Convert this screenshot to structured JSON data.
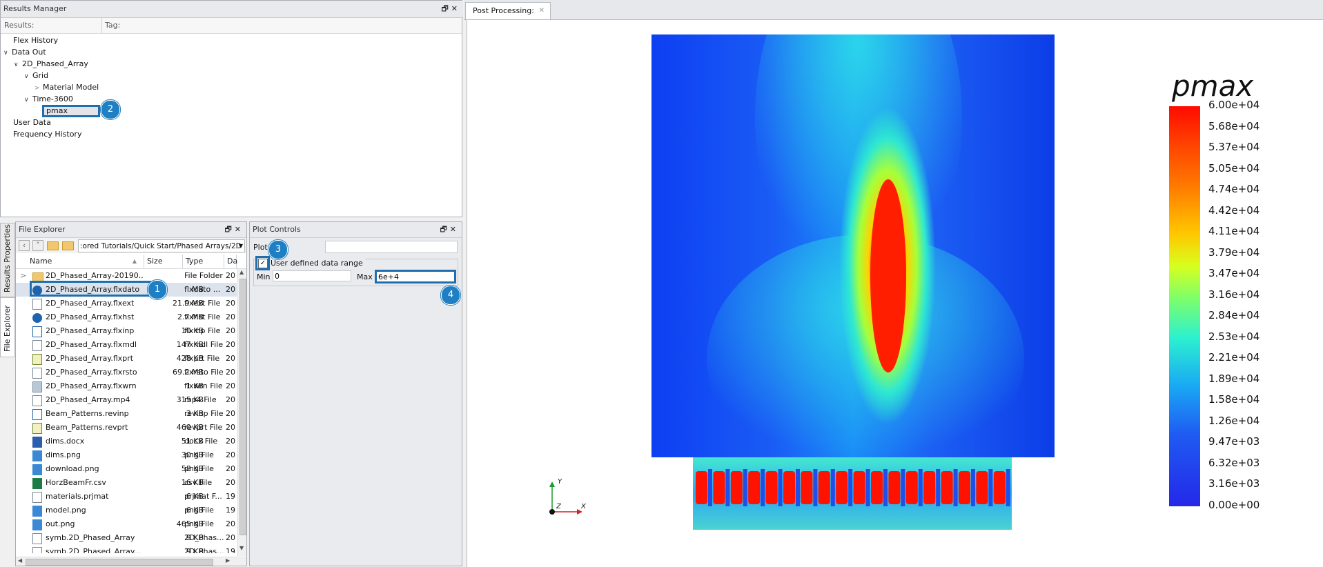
{
  "results_manager": {
    "title": "Results Manager",
    "col_results": "Results:",
    "col_tag": "Tag:",
    "items": [
      {
        "label": "Flex History"
      },
      {
        "label": "Data Out"
      },
      {
        "label": "2D_Phased_Array"
      },
      {
        "label": "Grid"
      },
      {
        "label": "Material Model"
      },
      {
        "label": "Time-3600"
      },
      {
        "label": "pmax"
      },
      {
        "label": "User Data"
      },
      {
        "label": "Frequency History"
      }
    ]
  },
  "side_tabs": {
    "results_properties": "Results Properties",
    "file_explorer": "File Explorer"
  },
  "file_explorer": {
    "title": "File Explorer",
    "path": ":ored Tutorials/Quick Start/Phased Arrays/2D",
    "columns": {
      "name": "Name",
      "size": "Size",
      "type": "Type",
      "date": "Da"
    },
    "files": [
      {
        "name": "2D_Phased_Array-20190...",
        "size": "",
        "type": "File Folder",
        "date": "20",
        "icon": "folder-icon"
      },
      {
        "name": "2D_Phased_Array.flxdato",
        "size": "MB",
        "type": "flxdato ...",
        "date": "20",
        "icon": "power-icon"
      },
      {
        "name": "2D_Phased_Array.flxext",
        "size": "21.9 MB",
        "type": "flxext File",
        "date": "20",
        "icon": "file-icon"
      },
      {
        "name": "2D_Phased_Array.flxhst",
        "size": "2.7 MB",
        "type": "flxhst File",
        "date": "20",
        "icon": "power-icon"
      },
      {
        "name": "2D_Phased_Array.flxinp",
        "size": "10 KB",
        "type": "flxinp File",
        "date": "20",
        "icon": "refresh-icon"
      },
      {
        "name": "2D_Phased_Array.flxmdl",
        "size": "147 KB",
        "type": "flxmdl File",
        "date": "20",
        "icon": "file-icon"
      },
      {
        "name": "2D_Phased_Array.flxprt",
        "size": "428 KB",
        "type": "flxprt File",
        "date": "20",
        "icon": "report-icon"
      },
      {
        "name": "2D_Phased_Array.flxrsto",
        "size": "69.2 MB",
        "type": "flxrsto File",
        "date": "20",
        "icon": "file-icon"
      },
      {
        "name": "2D_Phased_Array.flxwrn",
        "size": "1 KB",
        "type": "flxwrn File",
        "date": "20",
        "icon": "warning-file-icon"
      },
      {
        "name": "2D_Phased_Array.mp4",
        "size": "315 KB",
        "type": "mp4 File",
        "date": "20",
        "icon": "file-icon"
      },
      {
        "name": "Beam_Patterns.revinp",
        "size": "3 KB",
        "type": "revinp File",
        "date": "20",
        "icon": "refresh-icon"
      },
      {
        "name": "Beam_Patterns.revprt",
        "size": "460 KB",
        "type": "revprt File",
        "date": "20",
        "icon": "report-icon"
      },
      {
        "name": "dims.docx",
        "size": "51 KB",
        "type": "docx File",
        "date": "20",
        "icon": "word-icon"
      },
      {
        "name": "dims.png",
        "size": "30 KB",
        "type": "png File",
        "date": "20",
        "icon": "image-icon"
      },
      {
        "name": "download.png",
        "size": "58 KB",
        "type": "png File",
        "date": "20",
        "icon": "image-icon"
      },
      {
        "name": "HorzBeamFr.csv",
        "size": "16 KB",
        "type": "csv File",
        "date": "20",
        "icon": "excel-icon"
      },
      {
        "name": "materials.prjmat",
        "size": "6 KB",
        "type": "prjmat F...",
        "date": "19",
        "icon": "file-icon"
      },
      {
        "name": "model.png",
        "size": "6 KB",
        "type": "png File",
        "date": "19",
        "icon": "image-icon"
      },
      {
        "name": "out.png",
        "size": "465 KB",
        "type": "png File",
        "date": "20",
        "icon": "image-icon"
      },
      {
        "name": "symb.2D_Phased_Array",
        "size": "9 KB",
        "type": "2D_Phas...",
        "date": "20",
        "icon": "file-icon"
      },
      {
        "name": "symb.2D_Phased_Array...",
        "size": "9 KB",
        "type": "2D_Phas...",
        "date": "19",
        "icon": "file-icon"
      }
    ]
  },
  "plot_controls": {
    "title": "Plot Controls",
    "plot_label": "Plot",
    "plot_value": "",
    "group_label": "User defined data range",
    "checked": true,
    "min_label": "Min",
    "min_value": "0",
    "max_label": "Max",
    "max_value": "6e+4"
  },
  "post_processing": {
    "tab_label": "Post Processing:",
    "legend_title": "pmax",
    "legend_labels": [
      "6.00e+04",
      "5.68e+04",
      "5.37e+04",
      "5.05e+04",
      "4.74e+04",
      "4.42e+04",
      "4.11e+04",
      "3.79e+04",
      "3.47e+04",
      "3.16e+04",
      "2.84e+04",
      "2.53e+04",
      "2.21e+04",
      "1.89e+04",
      "1.58e+04",
      "1.26e+04",
      "9.47e+03",
      "6.32e+03",
      "3.16e+03",
      "0.00e+00"
    ],
    "axes": {
      "y": "Y",
      "x": "X",
      "z": "Z"
    }
  },
  "markers": [
    "1",
    "2",
    "3",
    "4"
  ],
  "colors": {
    "accent": "#1f7fc2",
    "field_bg": "#1a3cff",
    "hot": "#ff1a00"
  }
}
